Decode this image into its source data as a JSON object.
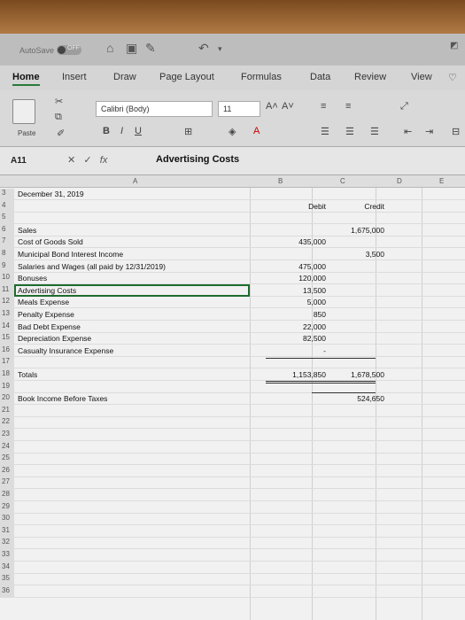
{
  "titlebar": {
    "autosave_label": "AutoSave",
    "autosave_state": "OFF"
  },
  "tabs": [
    "Home",
    "Insert",
    "Draw",
    "Page Layout",
    "Formulas",
    "Data",
    "Review",
    "View"
  ],
  "ribbon": {
    "paste_label": "Paste",
    "font_name": "Calibri (Body)",
    "font_size": "11"
  },
  "formula_bar": {
    "name_box": "A11",
    "formula": "Advertising Costs"
  },
  "columns": [
    "A",
    "B",
    "C",
    "D",
    "E"
  ],
  "rows": [
    {
      "n": "3",
      "a": "December 31, 2019",
      "b": "",
      "c": ""
    },
    {
      "n": "4",
      "a": "",
      "b": "Debit",
      "c": "Credit"
    },
    {
      "n": "5",
      "a": "",
      "b": "",
      "c": ""
    },
    {
      "n": "6",
      "a": "Sales",
      "b": "",
      "c": "1,675,000"
    },
    {
      "n": "7",
      "a": "Cost of Goods Sold",
      "b": "435,000",
      "c": ""
    },
    {
      "n": "8",
      "a": "Municipal Bond Interest Income",
      "b": "",
      "c": "3,500"
    },
    {
      "n": "9",
      "a": "Salaries and Wages (all paid by 12/31/2019)",
      "b": "475,000",
      "c": ""
    },
    {
      "n": "10",
      "a": "Bonuses",
      "b": "120,000",
      "c": ""
    },
    {
      "n": "11",
      "a": "Advertising Costs",
      "b": "13,500",
      "c": ""
    },
    {
      "n": "12",
      "a": "Meals Expense",
      "b": "5,000",
      "c": ""
    },
    {
      "n": "13",
      "a": "Penalty Expense",
      "b": "850",
      "c": ""
    },
    {
      "n": "14",
      "a": "Bad Debt Expense",
      "b": "22,000",
      "c": ""
    },
    {
      "n": "15",
      "a": "Depreciation Expense",
      "b": "82,500",
      "c": ""
    },
    {
      "n": "16",
      "a": "Casualty Insurance Expense",
      "b": "-",
      "c": ""
    },
    {
      "n": "17",
      "a": "",
      "b": "",
      "c": ""
    },
    {
      "n": "18",
      "a": "Totals",
      "b": "1,153,850",
      "c": "1,678,500"
    },
    {
      "n": "19",
      "a": "",
      "b": "",
      "c": ""
    },
    {
      "n": "20",
      "a": "Book Income Before Taxes",
      "b": "",
      "c": "524,650"
    },
    {
      "n": "21",
      "a": "",
      "b": "",
      "c": ""
    },
    {
      "n": "22",
      "a": "",
      "b": "",
      "c": ""
    },
    {
      "n": "23",
      "a": "",
      "b": "",
      "c": ""
    },
    {
      "n": "24",
      "a": "",
      "b": "",
      "c": ""
    },
    {
      "n": "25",
      "a": "",
      "b": "",
      "c": ""
    },
    {
      "n": "26",
      "a": "",
      "b": "",
      "c": ""
    },
    {
      "n": "27",
      "a": "",
      "b": "",
      "c": ""
    },
    {
      "n": "28",
      "a": "",
      "b": "",
      "c": ""
    },
    {
      "n": "29",
      "a": "",
      "b": "",
      "c": ""
    },
    {
      "n": "30",
      "a": "",
      "b": "",
      "c": ""
    },
    {
      "n": "31",
      "a": "",
      "b": "",
      "c": ""
    },
    {
      "n": "32",
      "a": "",
      "b": "",
      "c": ""
    },
    {
      "n": "33",
      "a": "",
      "b": "",
      "c": ""
    },
    {
      "n": "34",
      "a": "",
      "b": "",
      "c": ""
    },
    {
      "n": "35",
      "a": "",
      "b": "",
      "c": ""
    },
    {
      "n": "36",
      "a": "",
      "b": "",
      "c": ""
    }
  ],
  "selected_row": "11",
  "colors": {
    "accent": "#1f6b2e",
    "ribbon_bg": "#d9d9d9",
    "sheet_bg": "#f1f1f1"
  }
}
